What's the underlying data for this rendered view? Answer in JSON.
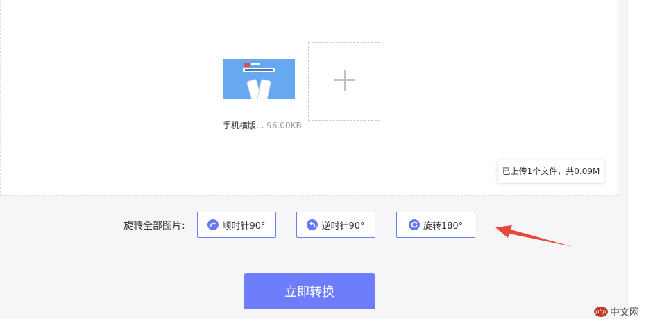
{
  "upload": {
    "file": {
      "name": "手机横版...",
      "size": "96.00KB",
      "thumbnail_colors": {
        "background": "#66a9f2",
        "logo": "#e84a3b"
      }
    },
    "add_icon": "plus-icon",
    "summary": "已上传1个文件，共0.09M"
  },
  "rotate": {
    "label": "旋转全部图片:",
    "buttons": [
      {
        "label": "顺时针90°",
        "icon": "rotate-clockwise-icon"
      },
      {
        "label": "逆时针90°",
        "icon": "rotate-counterclockwise-icon"
      },
      {
        "label": "旋转180°",
        "icon": "rotate-180-icon"
      }
    ]
  },
  "convert_button": "立即转换",
  "colors": {
    "accent": "#6e7dfb",
    "border_accent": "#6a7ef5",
    "icon_accent": "#6877f2",
    "arrow": "#e8473a"
  },
  "watermark": {
    "badge": "php",
    "text": "中文网"
  }
}
